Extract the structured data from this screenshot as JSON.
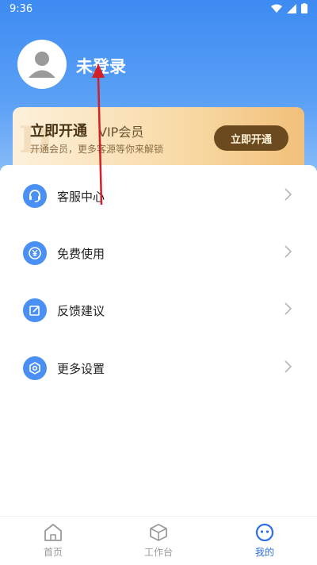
{
  "status_bar": {
    "time": "9:36"
  },
  "profile": {
    "username": "未登录",
    "avatar_icon": "user-avatar-icon"
  },
  "vip": {
    "title": "立即开通",
    "subtitle": "VIP会员",
    "description": "开通会员，更多客源等你来解锁",
    "button_label": "立即开通"
  },
  "menu": {
    "items": [
      {
        "label": "客服中心",
        "icon": "headset-icon"
      },
      {
        "label": "免费使用",
        "icon": "coin-icon"
      },
      {
        "label": "反馈建议",
        "icon": "edit-icon"
      },
      {
        "label": "更多设置",
        "icon": "settings-icon"
      }
    ]
  },
  "tabs": [
    {
      "label": "首页",
      "icon": "home-icon",
      "active": false
    },
    {
      "label": "工作台",
      "icon": "cube-icon",
      "active": false
    },
    {
      "label": "我的",
      "icon": "profile-icon",
      "active": true
    }
  ],
  "colors": {
    "primary": "#4a8ff4",
    "header_gradient_top": "#3d8bf2",
    "vip_button": "#6b4a1f",
    "tab_active": "#2e6df0",
    "annotation_arrow": "#d0202a"
  }
}
